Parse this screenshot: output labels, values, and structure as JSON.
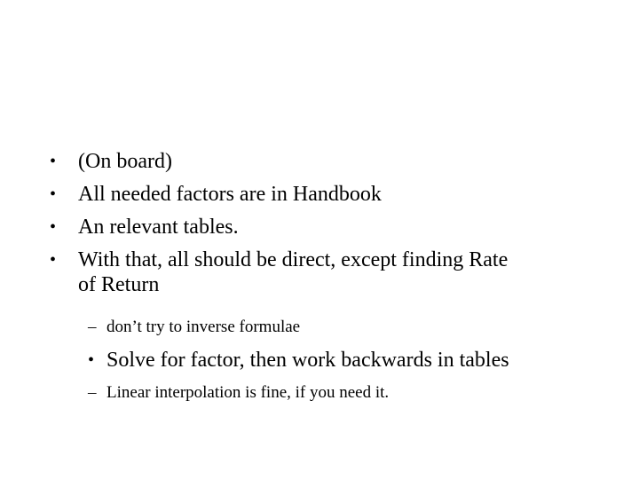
{
  "slide": {
    "bullets": [
      {
        "marker": "•",
        "text": "(On board)"
      },
      {
        "marker": "•",
        "text": "All needed factors are in Handbook"
      },
      {
        "marker": "•",
        "text": "An relevant tables."
      },
      {
        "marker": "•",
        "text": "With that, all should be direct, except finding Rate",
        "continuation": "of Return"
      },
      {
        "marker": "–",
        "text": "don’t try to inverse formulae"
      },
      {
        "marker": "•",
        "text": "Solve for factor, then work backwards in tables"
      },
      {
        "marker": "–",
        "text": "Linear interpolation is fine, if you need it."
      }
    ]
  }
}
